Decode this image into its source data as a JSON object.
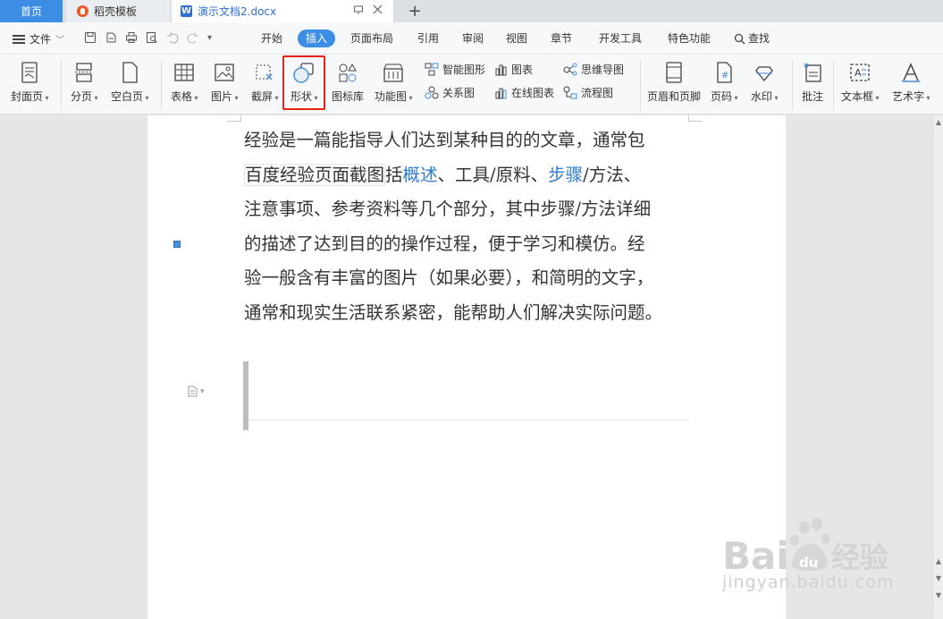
{
  "tabs": {
    "home": "首页",
    "daoke": "稻壳模板",
    "doc": "演示文档2.docx",
    "new_tab": "+"
  },
  "menu": {
    "file": "文件",
    "tabs": [
      {
        "label": "开始"
      },
      {
        "label": "插入",
        "active": true
      },
      {
        "label": "页面布局"
      },
      {
        "label": "引用"
      },
      {
        "label": "审阅"
      },
      {
        "label": "视图"
      },
      {
        "label": "章节"
      },
      {
        "label": "开发工具"
      },
      {
        "label": "特色功能"
      },
      {
        "label": "查找"
      }
    ]
  },
  "ribbon": {
    "cover": "封面页",
    "pagebreak": "分页",
    "blank": "空白页",
    "table": "表格",
    "picture": "图片",
    "screenshot": "截屏",
    "shape": "形状",
    "iconlib": "图标库",
    "funcmap": "功能图",
    "smartart": "智能图形",
    "relation": "关系图",
    "chart": "图表",
    "onlinechart": "在线图表",
    "mindmap": "思维导图",
    "flowchart": "流程图",
    "header_footer": "页眉和页脚",
    "pagenum": "页码",
    "watermark": "水印",
    "comment": "批注",
    "textbox": "文本框",
    "wordart": "艺术字"
  },
  "document": {
    "lines": [
      {
        "parts": [
          "经验是一篇能指导人们达到某种目的的文章，通常包"
        ]
      },
      {
        "boxed": "百度经验页面截图",
        "parts": [
          "括",
          "概述",
          "、工具/原料、",
          "步骤",
          "/方法、"
        ]
      },
      {
        "parts": [
          "注意事项、参考资料等几个部分，其中步骤/方法详细"
        ]
      },
      {
        "parts": [
          "的描述了达到目的的操作过程，便于学习和模仿。经"
        ]
      },
      {
        "parts": [
          "验一般含有丰富的图片（如果必要），和简明的文字，"
        ]
      },
      {
        "parts": [
          "通常和现实生活联系紧密，能帮助人们解决实际问题。"
        ]
      }
    ]
  },
  "watermark_text": "jingyan.baidu.com",
  "colors": {
    "accent": "#3c8ee4",
    "link": "#2d7cd1",
    "highlight": "#e8221b"
  }
}
